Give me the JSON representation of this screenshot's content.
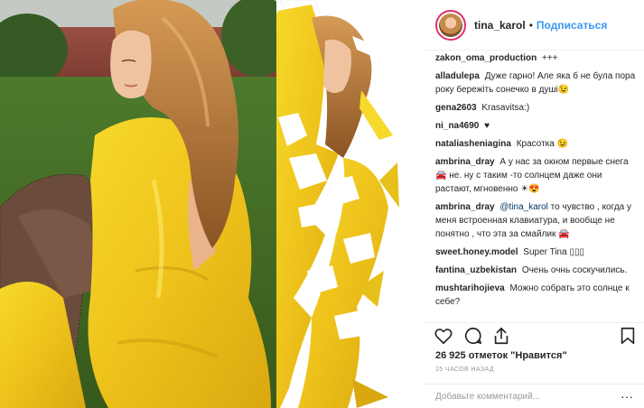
{
  "header": {
    "username": "tina_karol",
    "separator": "•",
    "follow_label": "Подписаться"
  },
  "comments": [
    {
      "author": "zakon_oma_production",
      "text": "+++"
    },
    {
      "author": "alladulepa",
      "text": "Дуже гарно! Але яка б не була пора року бережіть сонечко в душі😉"
    },
    {
      "author": "gena2603",
      "text": "Krasavitsa:)"
    },
    {
      "author": "ni_na4690",
      "text": "♥"
    },
    {
      "author": "nataliasheniagina",
      "text": "Красотка 😉"
    },
    {
      "author": "ambrina_dray",
      "text": "А у нас за окном первые снега 🚘 не. ну с таким -то солнцем даже они растают, мгновенно ☀😍"
    },
    {
      "author": "ambrina_dray",
      "mention": "@tina_karol",
      "text": "то чувство , когда у меня встроенная клавиатура, и вообще не понятно , что эта за смайлик 🚘"
    },
    {
      "author": "sweet.honey.model",
      "text": "Super Tina ▯▯▯"
    },
    {
      "author": "fantina_uzbekistan",
      "text": "Очень очнь соскучились."
    },
    {
      "author": "mushtarihojieva",
      "text": "Можно собрать это солнце к себе?"
    }
  ],
  "actions": {
    "like_icon": "heart-icon",
    "comment_icon": "comment-icon",
    "share_icon": "share-icon",
    "save_icon": "bookmark-icon"
  },
  "likes_text": "26 925 отметок \"Нравится\"",
  "time_text": "15 ЧАСОВ НАЗАД",
  "add_comment": {
    "placeholder": "Добавьте комментарий...",
    "more_label": "···"
  },
  "colors": {
    "accent": "#3897f0",
    "dress_yellow": "#f2cc1e",
    "grass": "#4f7a2a",
    "hair": "#a8672c"
  }
}
